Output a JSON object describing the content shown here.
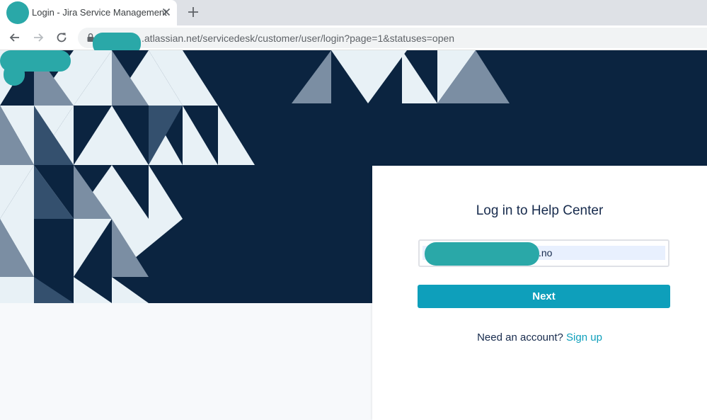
{
  "browser": {
    "tab_title": "Login - Jira Service Management",
    "url": ".atlassian.net/servicedesk/customer/user/login?page=1&statuses=open",
    "icons": [
      "back-arrow-icon",
      "forward-arrow-icon",
      "reload-icon",
      "lock-icon",
      "close-icon",
      "plus-icon"
    ]
  },
  "login": {
    "title": "Log in to Help Center",
    "email_value": ".no",
    "next_label": "Next",
    "signup_prompt": "Need an account?",
    "signup_link": "Sign up"
  },
  "colors": {
    "hero_background": "#0b2440",
    "primary_button": "#0e9fbb",
    "link": "#0e9fbb",
    "redaction": "#2aa8a8"
  }
}
